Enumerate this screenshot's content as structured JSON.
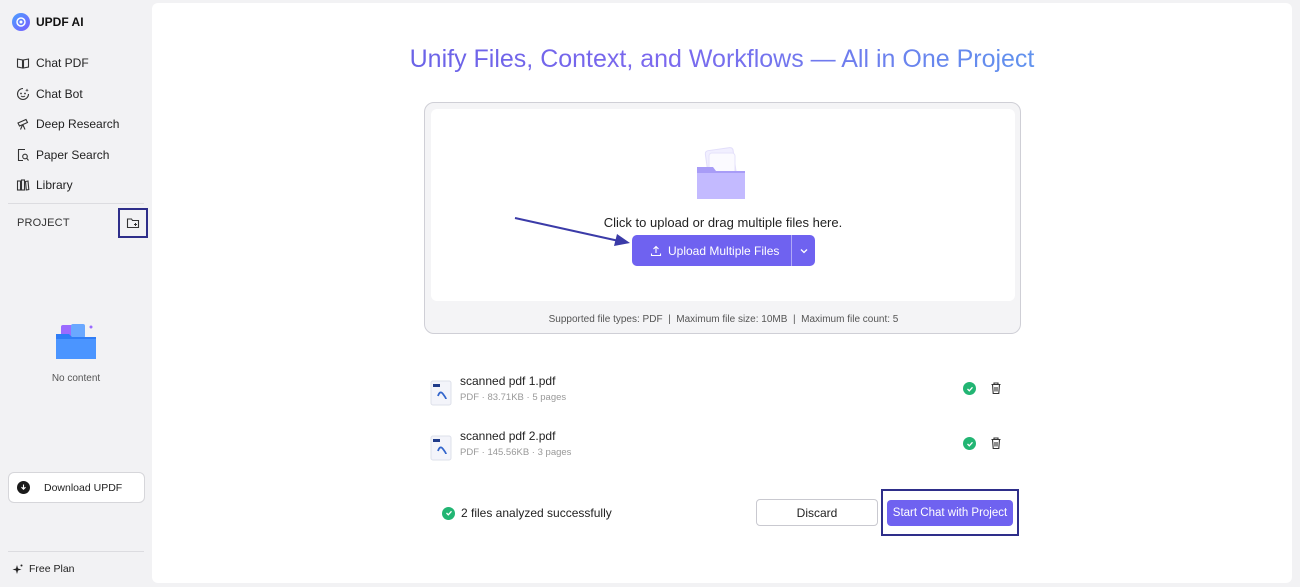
{
  "brand": {
    "name": "UPDF AI",
    "logo_icon": "updf-logo-icon"
  },
  "sidebar": {
    "items": [
      {
        "label": "Chat PDF",
        "icon": "book-icon"
      },
      {
        "label": "Chat Bot",
        "icon": "bot-icon"
      },
      {
        "label": "Deep Research",
        "icon": "telescope-icon"
      },
      {
        "label": "Paper Search",
        "icon": "paper-search-icon"
      },
      {
        "label": "Library",
        "icon": "library-icon"
      }
    ],
    "project_label": "PROJECT",
    "empty_text": "No content",
    "download_label": "Download UPDF",
    "plan_label": "Free Plan"
  },
  "main": {
    "title": "Unify Files, Context, and Workflows — All in One Project",
    "upload": {
      "hint": "Click to upload or drag multiple files here.",
      "button_label": "Upload Multiple Files",
      "supported": "Supported file types: PDF  |  Maximum file size: 10MB  |  Maximum file count: 5"
    },
    "files": [
      {
        "name": "scanned pdf 1.pdf",
        "meta": "PDF · 83.71KB · 5 pages"
      },
      {
        "name": "scanned pdf 2.pdf",
        "meta": "PDF · 145.56KB · 3 pages"
      }
    ],
    "status_text": "2 files analyzed successfully",
    "discard_label": "Discard",
    "start_label": "Start Chat with Project"
  },
  "colors": {
    "accent": "#6f62f0",
    "highlight_frame": "#2e2e8a",
    "success": "#22b573"
  }
}
